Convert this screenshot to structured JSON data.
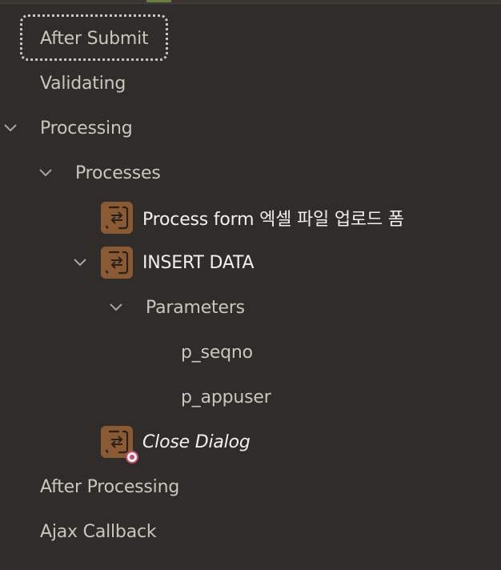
{
  "tree": {
    "after_submit": {
      "label": "After Submit",
      "icon": "none"
    },
    "validating": {
      "label": "Validating"
    },
    "processing": {
      "label": "Processing",
      "expanded": true,
      "icon": "chevron-down-icon"
    },
    "processes": {
      "label": "Processes",
      "expanded": true,
      "icon": "chevron-down-icon"
    },
    "process_form": {
      "label": "Process form 엑셀 파일 업로드 폼",
      "icon": "process-icon"
    },
    "insert_data": {
      "label": "INSERT DATA",
      "expanded": true,
      "icon": "process-icon"
    },
    "parameters": {
      "label": "Parameters",
      "expanded": true,
      "icon": "chevron-down-icon"
    },
    "p_seqno": {
      "label": "p_seqno"
    },
    "p_appuser": {
      "label": "p_appuser"
    },
    "close_dialog": {
      "label": "Close Dialog",
      "icon": "process-icon",
      "badge": "conditional-badge-icon"
    },
    "after_processing": {
      "label": "After Processing"
    },
    "ajax_callback": {
      "label": "Ajax Callback"
    }
  },
  "colors": {
    "background": "#2f2c29",
    "text": "#c9c6c1",
    "text_strong": "#f2f0ec",
    "process_icon": "#8a5a34",
    "badge": "#c14d72"
  }
}
